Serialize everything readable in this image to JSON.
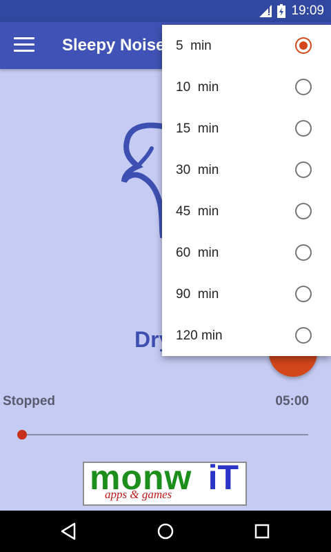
{
  "status_bar": {
    "time": "19:09",
    "icons": [
      "signal-icon",
      "battery-charging-icon"
    ]
  },
  "app_bar": {
    "title": "Sleepy Noises",
    "menu_icon": "hamburger-menu-icon"
  },
  "player": {
    "sound_name": "Dry",
    "status": "Stopped",
    "time": "05:00",
    "progress": 0,
    "play_icon": "play-icon",
    "accent": "#d2461a"
  },
  "ad": {
    "brand": "monw",
    "brand_suffix": "iT",
    "tagline": "apps & games"
  },
  "timer_menu": {
    "selected": "5  min",
    "options": [
      "5  min",
      "10  min",
      "15  min",
      "30  min",
      "45  min",
      "60  min",
      "90  min",
      "120 min"
    ]
  },
  "nav": {
    "back_icon": "back-icon",
    "home_icon": "home-icon",
    "recents_icon": "recents-icon"
  },
  "colors": {
    "app_bar": "#4052b5",
    "status_bar": "#3248a0",
    "background": "#c5cbf2"
  }
}
